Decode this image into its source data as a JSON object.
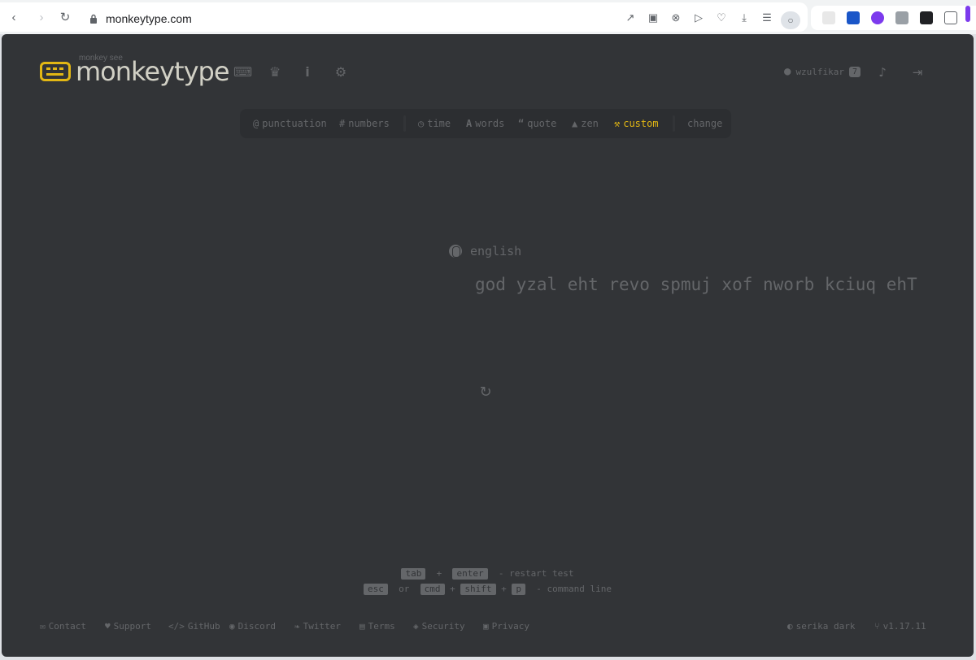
{
  "browser": {
    "url": "monkeytype.com"
  },
  "logo": {
    "small_text": "monkey see",
    "title": "monkeytype"
  },
  "account": {
    "username": "wzulfikar",
    "level": "7"
  },
  "config_bar": {
    "punctuation": "punctuation",
    "numbers": "numbers",
    "time": "time",
    "words": "words",
    "quote": "quote",
    "zen": "zen",
    "custom": "custom",
    "change": "change"
  },
  "test": {
    "language": "english",
    "words": "god yzal eht revo spmuj xof nworb kciuq ehT"
  },
  "hints": {
    "key_tab": "tab",
    "plus": "+",
    "key_enter": "enter",
    "restart_label": "- restart test",
    "key_esc": "esc",
    "or": "or",
    "key_cmd": "cmd",
    "key_shift": "shift",
    "key_p": "p",
    "command_label": "- command line"
  },
  "footer": {
    "contact": "Contact",
    "support": "Support",
    "github": "GitHub",
    "discord": "Discord",
    "twitter": "Twitter",
    "terms": "Terms",
    "security": "Security",
    "privacy": "Privacy",
    "theme": "serika dark",
    "version": "v1.17.11"
  },
  "colors": {
    "background": "#323437",
    "accent": "#e2b714",
    "sub": "#646669",
    "text": "#d1d0c5"
  }
}
